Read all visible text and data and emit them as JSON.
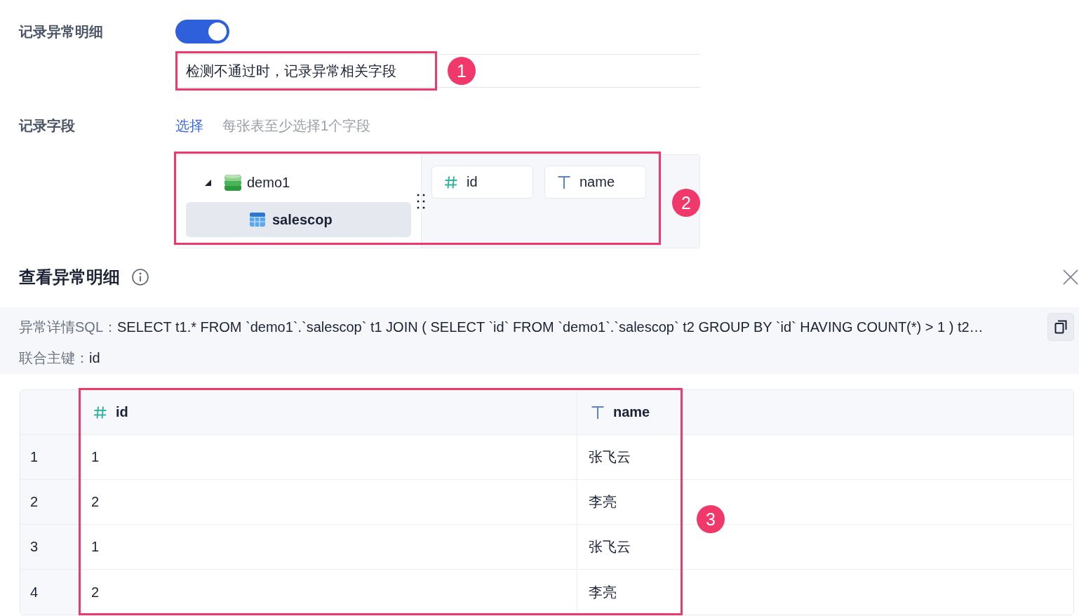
{
  "record_detail": {
    "label": "记录异常明细",
    "toggle_on": true,
    "description": "检测不通过时，记录异常相关字段",
    "callout": "1"
  },
  "record_fields": {
    "label": "记录字段",
    "select_link": "选择",
    "hint": "每张表至少选择1个字段",
    "tree": [
      {
        "label": "demo1",
        "kind": "database",
        "expanded": true,
        "selected": false,
        "children": [
          {
            "label": "salescop",
            "kind": "table",
            "selected": true
          }
        ]
      }
    ],
    "fields": [
      {
        "name": "id",
        "kind": "number"
      },
      {
        "name": "name",
        "kind": "text"
      }
    ],
    "callout": "2"
  },
  "detail_panel": {
    "title": "查看异常明细",
    "sql_label": "异常详情SQL：",
    "sql": "SELECT t1.* FROM `demo1`.`salescop` t1 JOIN ( SELECT `id` FROM `demo1`.`salescop` t2 GROUP BY `id` HAVING COUNT(*) > 1 ) t2…",
    "key_label": "联合主键：",
    "key_value": "id",
    "table": {
      "columns": [
        {
          "label": "id",
          "kind": "number"
        },
        {
          "label": "name",
          "kind": "text"
        }
      ],
      "rows": [
        {
          "number": "1",
          "cells": [
            "1",
            "张飞云"
          ]
        },
        {
          "number": "2",
          "cells": [
            "2",
            "李亮"
          ]
        },
        {
          "number": "3",
          "cells": [
            "1",
            "张飞云"
          ]
        },
        {
          "number": "4",
          "cells": [
            "2",
            "李亮"
          ]
        }
      ],
      "callout": "3"
    }
  }
}
